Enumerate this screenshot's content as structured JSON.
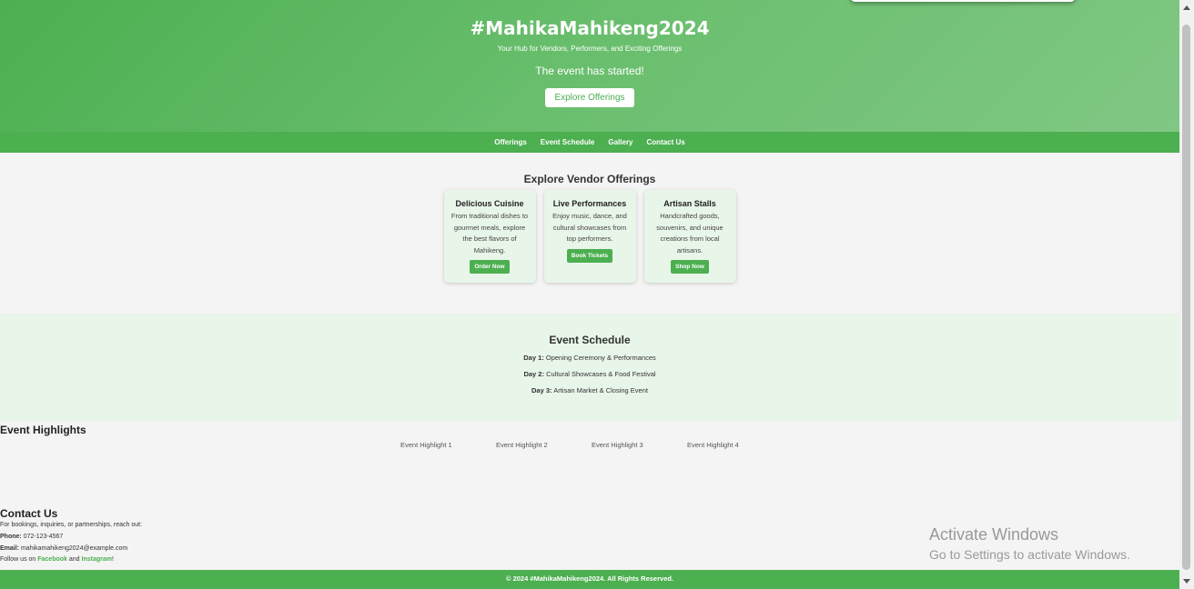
{
  "hero": {
    "title": "#MahikaMahikeng2024",
    "tagline": "Your Hub for Vendors, Performers, and Exciting Offerings",
    "status": "The event has started!",
    "cta_label": "Explore Offerings"
  },
  "nav": {
    "items": [
      "Offerings",
      "Event Schedule",
      "Gallery",
      "Contact Us"
    ]
  },
  "offerings": {
    "title": "Explore Vendor Offerings",
    "cards": [
      {
        "title": "Delicious Cuisine",
        "description": "From traditional dishes to gourmet meals, explore the best flavors of Mahikeng.",
        "button": "Order Now"
      },
      {
        "title": "Live Performances",
        "description": "Enjoy music, dance, and cultural showcases from top performers.",
        "button": "Book Tickets"
      },
      {
        "title": "Artisan Stalls",
        "description": "Handcrafted goods, souvenirs, and unique creations from local artisans.",
        "button": "Shop Now"
      }
    ]
  },
  "schedule": {
    "title": "Event Schedule",
    "days": [
      {
        "label": "Day 1:",
        "text": "Opening Ceremony & Performances"
      },
      {
        "label": "Day 2:",
        "text": "Cultural Showcases & Food Festival"
      },
      {
        "label": "Day 3:",
        "text": "Artisan Market & Closing Event"
      }
    ]
  },
  "gallery": {
    "title": "Event Highlights",
    "images": [
      "Event Highlight 1",
      "Event Highlight 2",
      "Event Highlight 3",
      "Event Highlight 4"
    ]
  },
  "contact": {
    "title": "Contact Us",
    "intro": "For bookings, inquiries, or partnerships, reach out:",
    "phone_label": "Phone:",
    "phone": "072-123-4567",
    "email_label": "Email:",
    "email": "mahikamahikeng2024@example.com",
    "follow_prefix": "Follow us on",
    "facebook": "Facebook",
    "and": "and",
    "instagram": "Instagram",
    "follow_suffix": "!"
  },
  "footer": {
    "text": "© 2024 #MahikaMahikeng2024. All Rights Reserved."
  },
  "watermark": {
    "line1": "Activate Windows",
    "line2": "Go to Settings to activate Windows."
  }
}
